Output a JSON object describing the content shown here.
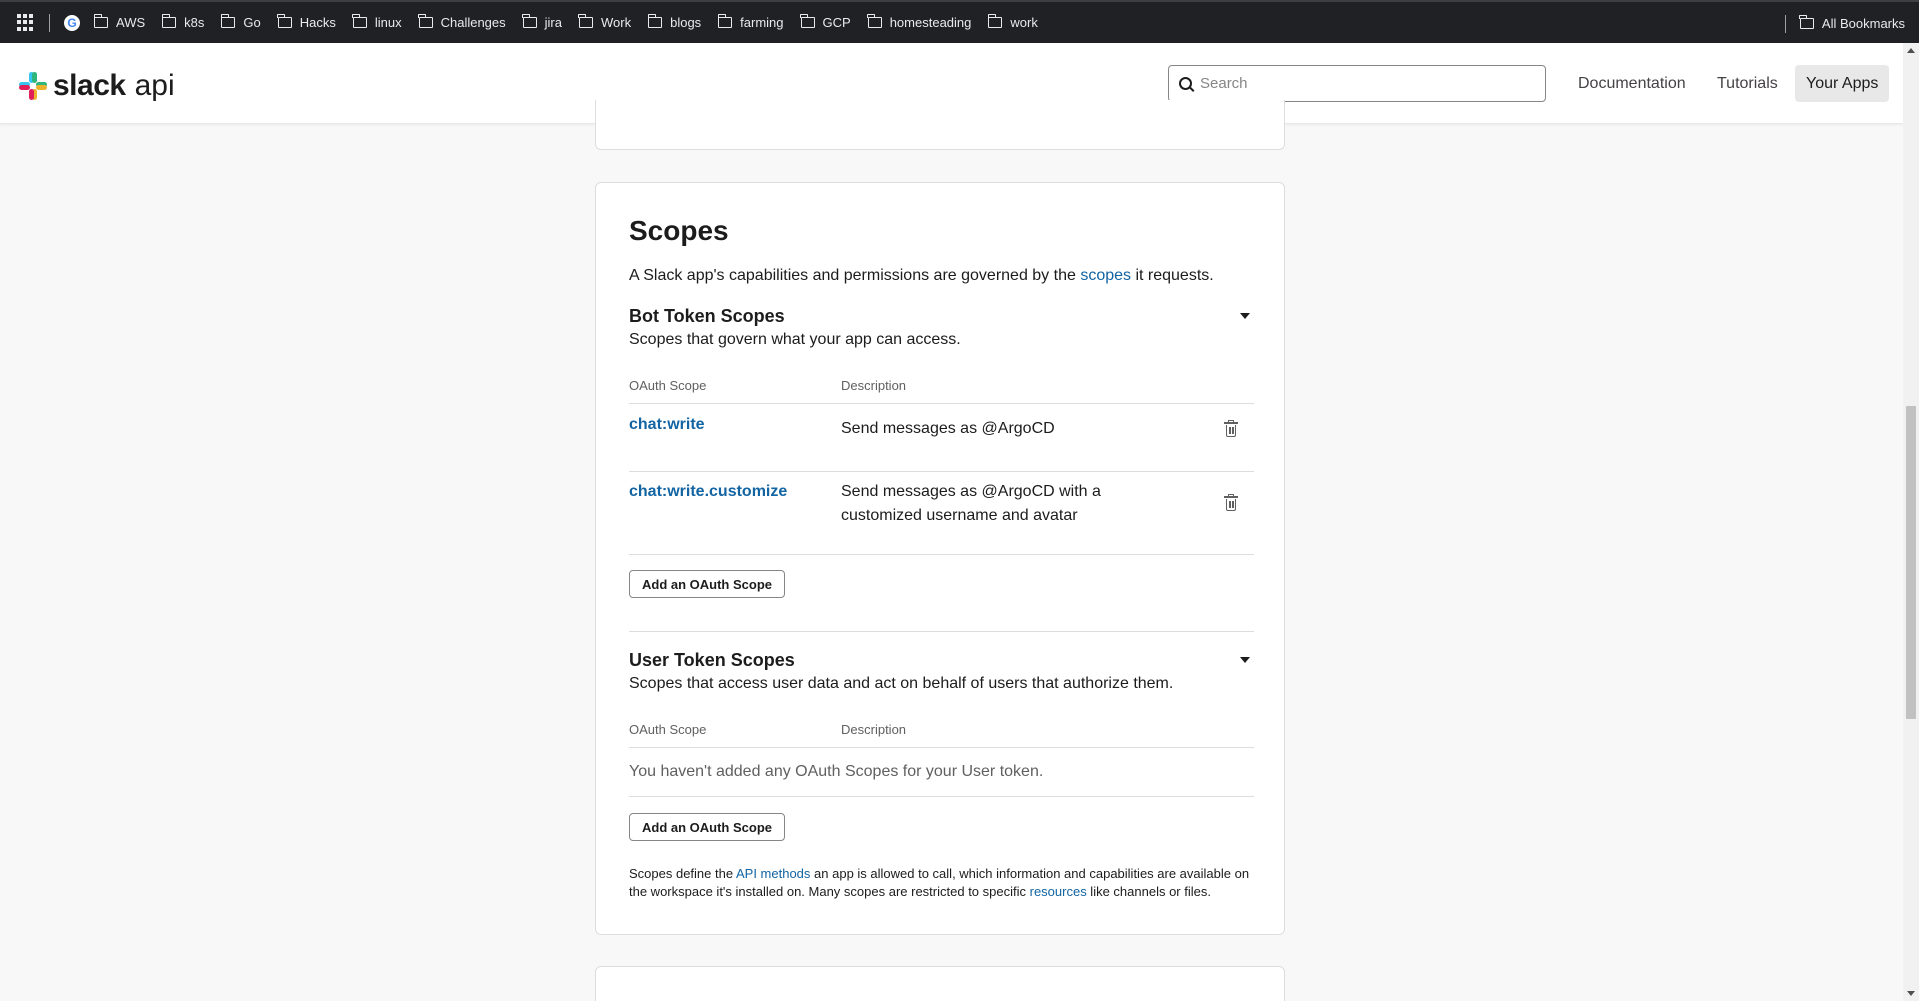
{
  "bookmarks": {
    "items": [
      "AWS",
      "k8s",
      "Go",
      "Hacks",
      "linux",
      "Challenges",
      "jira",
      "Work",
      "blogs",
      "farming",
      "GCP",
      "homesteading",
      "work"
    ],
    "all_bookmarks": "All Bookmarks"
  },
  "header": {
    "logo_text": "slack",
    "logo_api": "api",
    "search_placeholder": "Search",
    "nav": {
      "documentation": "Documentation",
      "tutorials": "Tutorials",
      "your_apps": "Your Apps"
    }
  },
  "scopes": {
    "title": "Scopes",
    "intro_before": "A Slack app's capabilities and permissions are governed by the ",
    "intro_link": "scopes",
    "intro_after": " it requests.",
    "bot": {
      "title": "Bot Token Scopes",
      "subtitle": "Scopes that govern what your app can access.",
      "col_scope": "OAuth Scope",
      "col_desc": "Description",
      "rows": [
        {
          "scope": "chat:write",
          "description": "Send messages as @ArgoCD"
        },
        {
          "scope": "chat:write.customize",
          "description": "Send messages as @ArgoCD with a customized username and avatar"
        }
      ],
      "add_button": "Add an OAuth Scope"
    },
    "user": {
      "title": "User Token Scopes",
      "subtitle": "Scopes that access user data and act on behalf of users that authorize them.",
      "col_scope": "OAuth Scope",
      "col_desc": "Description",
      "empty": "You haven't added any OAuth Scopes for your User token.",
      "add_button": "Add an OAuth Scope"
    },
    "footnote": {
      "part1": "Scopes define the ",
      "link1": "API methods",
      "part2": " an app is allowed to call, which information and capabilities are available on the workspace it's installed on. Many scopes are restricted to specific ",
      "link2": "resources",
      "part3": " like channels or files."
    }
  },
  "colors": {
    "link": "#1264a3",
    "text": "#1d1c1d",
    "muted": "#616061",
    "background": "#f8f8f8"
  }
}
